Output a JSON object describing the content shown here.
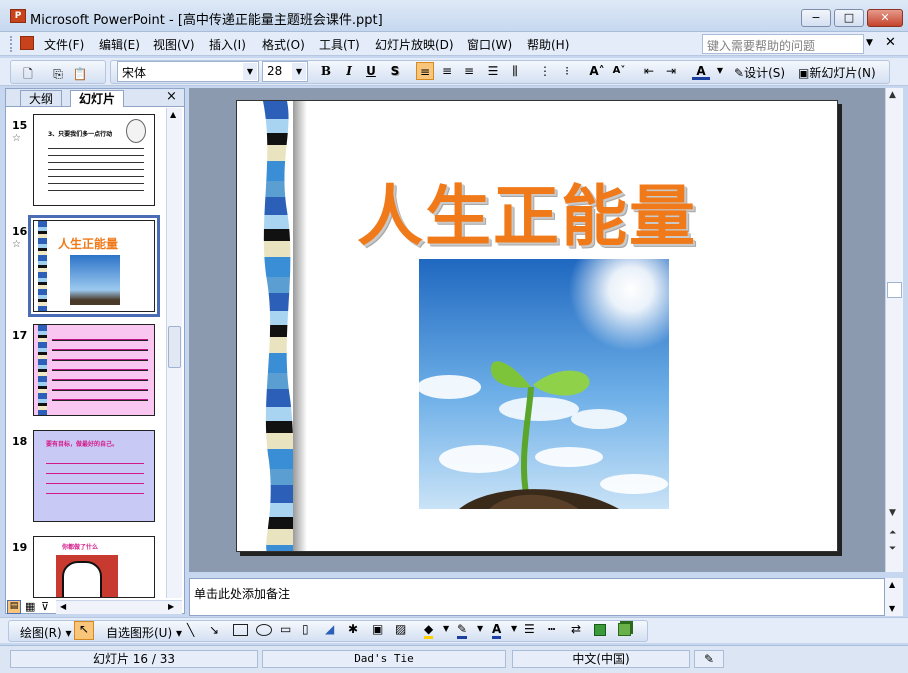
{
  "window": {
    "title": "Microsoft PowerPoint - [高中传递正能量主题班会课件.ppt]",
    "minimize": "−",
    "maximize": "□",
    "close": "✕"
  },
  "menu": {
    "items": [
      "文件(F)",
      "编辑(E)",
      "视图(V)",
      "插入(I)",
      "格式(O)",
      "工具(T)",
      "幻灯片放映(D)",
      "窗口(W)",
      "帮助(H)"
    ],
    "help_placeholder": "键入需要帮助的问题"
  },
  "toolbar": {
    "font_name": "宋体",
    "font_size": "28",
    "bold": "B",
    "italic": "I",
    "underline": "U",
    "shadow": "S",
    "design_label": "设计(S)",
    "new_slide_label": "新幻灯片(N)"
  },
  "left_panel": {
    "tab_outline": "大纲",
    "tab_slides": "幻灯片",
    "close": "×",
    "thumbnails": [
      {
        "number": "15",
        "star": "☆",
        "title": "3、只要我们多一点行动"
      },
      {
        "number": "16",
        "star": "☆",
        "title": "人生正能量",
        "selected": true
      },
      {
        "number": "17",
        "star": "",
        "title": ""
      },
      {
        "number": "18",
        "star": "",
        "title": "要有目标，做最好的自己。"
      },
      {
        "number": "19",
        "star": "",
        "title": "你都做了什么"
      }
    ]
  },
  "slide": {
    "title": "人生正能量",
    "title_color": "#f07a1a"
  },
  "notes": {
    "placeholder": "单击此处添加备注"
  },
  "drawbar": {
    "draw_label": "绘图(R)",
    "autoshapes_label": "自选图形(U)"
  },
  "status": {
    "slide_pos": "幻灯片 16 / 33",
    "design": "Dad's Tie",
    "language": "中文(中国)"
  }
}
